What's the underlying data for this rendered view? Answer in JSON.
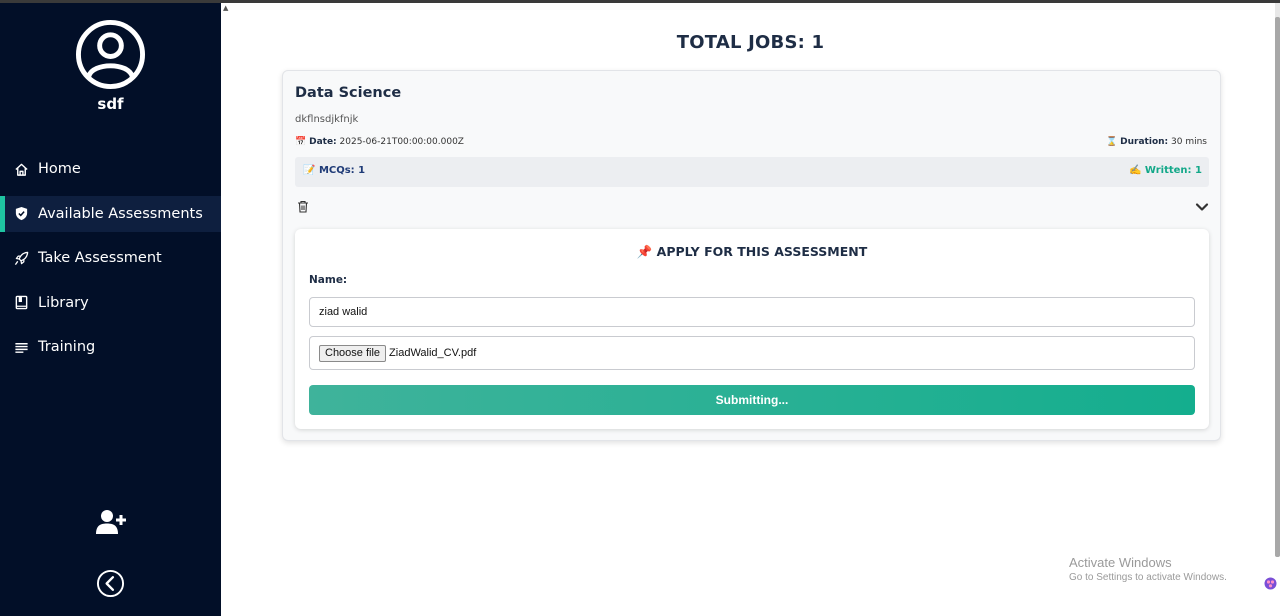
{
  "sidebar": {
    "username": "sdf",
    "items": [
      {
        "label": "Home",
        "icon": "home-icon"
      },
      {
        "label": "Available Assessments",
        "icon": "shield-check-icon"
      },
      {
        "label": "Take Assessment",
        "icon": "rocket-icon"
      },
      {
        "label": "Library",
        "icon": "book-icon"
      },
      {
        "label": "Training",
        "icon": "list-icon"
      }
    ],
    "active_item": "Available Assessments"
  },
  "main": {
    "total_jobs": "TOTAL JOBS: 1"
  },
  "job": {
    "title": "Data Science",
    "description": "dkflnsdjkfnjk",
    "date_label": "Date:",
    "date_value": "2025-06-21T00:00:00.000Z",
    "duration_label": "Duration:",
    "duration_value": "30 mins",
    "mcqs": "MCQs: 1",
    "written": "Written: 1"
  },
  "apply_form": {
    "title": "APPLY FOR THIS ASSESSMENT",
    "name_label": "Name:",
    "name_value": "ziad walid",
    "choose_file_label": "Choose file",
    "file_name": "ZiadWalid_CV.pdf",
    "submit_label": "Submitting..."
  },
  "watermark": {
    "line1": "Activate Windows",
    "line2": "Go to Settings to activate Windows."
  },
  "colors": {
    "sidebar_bg": "#020f28",
    "accent": "#1fc4a2",
    "submit_start": "#3fb39b",
    "submit_end": "#14ae8e",
    "heading": "#1e2d45"
  }
}
